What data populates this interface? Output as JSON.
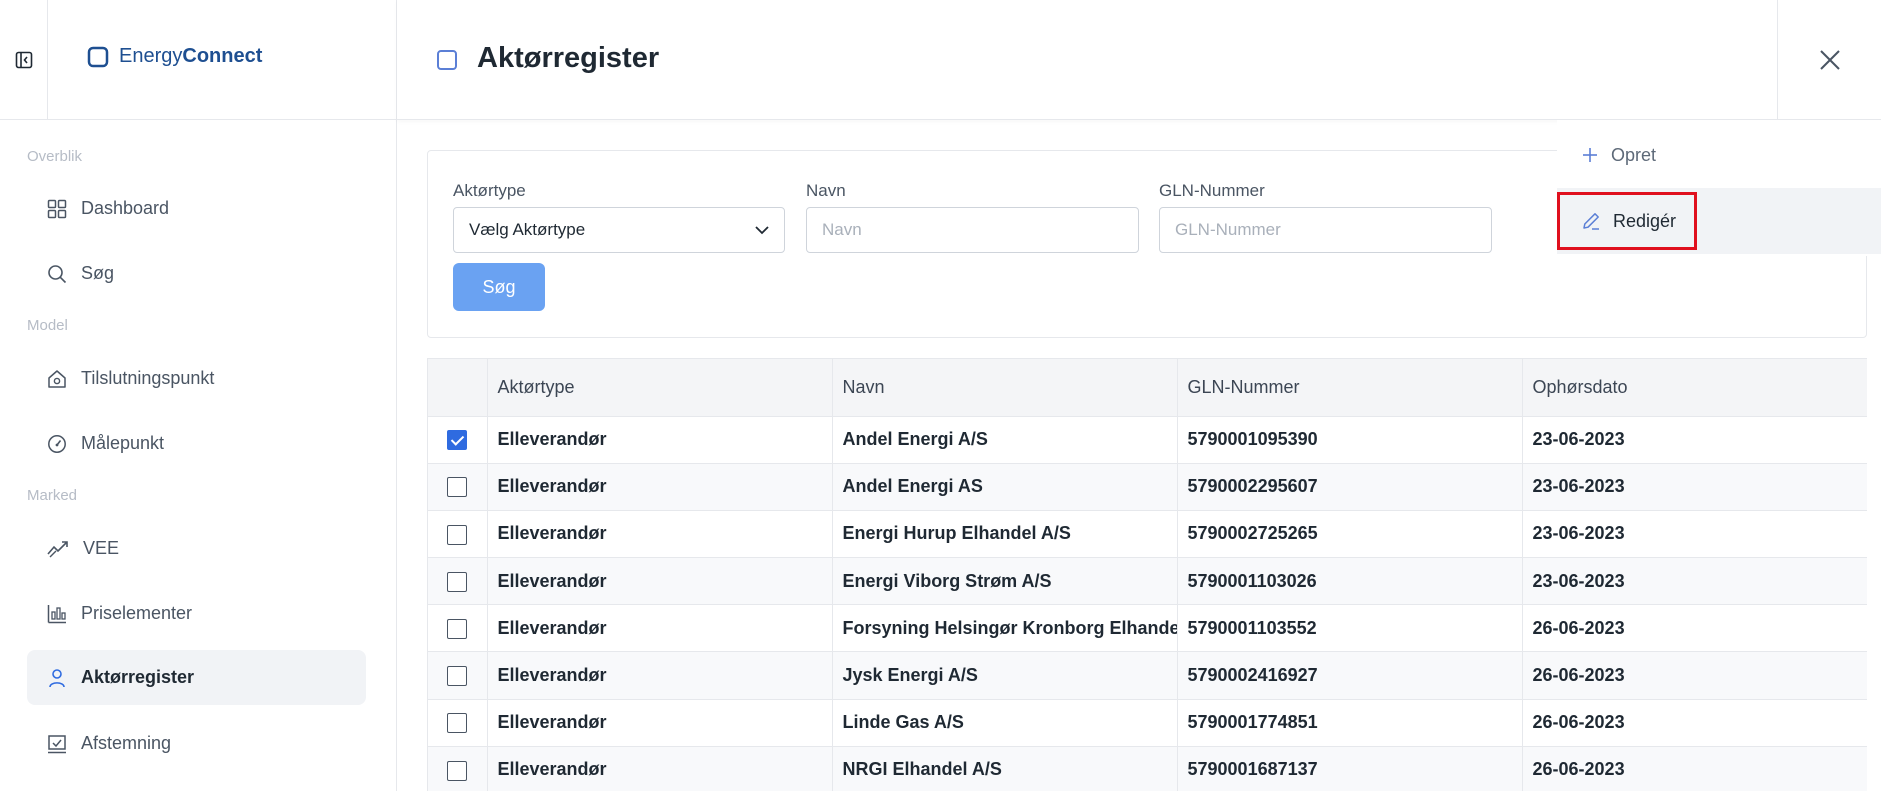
{
  "brand": {
    "name_part1": "Energy",
    "name_part2": "Connect",
    "color": "#1e4f91"
  },
  "header": {
    "title": "Aktørregister"
  },
  "sidebar": {
    "sections": [
      {
        "label": "Overblik",
        "items": [
          {
            "label": "Dashboard",
            "icon": "grid-icon"
          },
          {
            "label": "Søg",
            "icon": "search-icon"
          }
        ]
      },
      {
        "label": "Model",
        "items": [
          {
            "label": "Tilslutningspunkt",
            "icon": "house-plug-icon"
          },
          {
            "label": "Målepunkt",
            "icon": "gauge-icon"
          }
        ]
      },
      {
        "label": "Marked",
        "items": [
          {
            "label": "VEE",
            "icon": "trend-icon"
          },
          {
            "label": "Priselementer",
            "icon": "chart-bars-icon"
          },
          {
            "label": "Aktørregister",
            "icon": "user-icon",
            "active": true
          },
          {
            "label": "Afstemning",
            "icon": "checkbox-chart-icon"
          }
        ]
      }
    ]
  },
  "filters": {
    "aktortype_label": "Aktørtype",
    "aktortype_value": "Vælg Aktørtype",
    "navn_label": "Navn",
    "navn_placeholder": "Navn",
    "gln_label": "GLN-Nummer",
    "gln_placeholder": "GLN-Nummer",
    "search_button": "Søg"
  },
  "actions": {
    "create": "Opret",
    "edit": "Redigér"
  },
  "table": {
    "columns": [
      "Aktørtype",
      "Navn",
      "GLN-Nummer",
      "Ophørsdato"
    ],
    "rows": [
      {
        "checked": true,
        "type": "Elleverandør",
        "name": "Andel Energi A/S",
        "gln": "5790001095390",
        "date": "23-06-2023"
      },
      {
        "checked": false,
        "type": "Elleverandør",
        "name": "Andel Energi AS",
        "gln": "5790002295607",
        "date": "23-06-2023"
      },
      {
        "checked": false,
        "type": "Elleverandør",
        "name": "Energi Hurup Elhandel A/S",
        "gln": "5790002725265",
        "date": "23-06-2023"
      },
      {
        "checked": false,
        "type": "Elleverandør",
        "name": "Energi Viborg Strøm A/S",
        "gln": "5790001103026",
        "date": "23-06-2023"
      },
      {
        "checked": false,
        "type": "Elleverandør",
        "name": "Forsyning Helsingør Kronborg Elhandel A/S",
        "gln": "5790001103552",
        "date": "26-06-2023"
      },
      {
        "checked": false,
        "type": "Elleverandør",
        "name": "Jysk Energi A/S",
        "gln": "5790002416927",
        "date": "26-06-2023"
      },
      {
        "checked": false,
        "type": "Elleverandør",
        "name": "Linde Gas A/S",
        "gln": "5790001774851",
        "date": "26-06-2023"
      },
      {
        "checked": false,
        "type": "Elleverandør",
        "name": "NRGI Elhandel A/S",
        "gln": "5790001687137",
        "date": "26-06-2023"
      }
    ]
  },
  "colors": {
    "primary_button": "#6aa2f2",
    "checkbox_checked": "#2f6be0",
    "highlight_box": "#e0101e"
  }
}
